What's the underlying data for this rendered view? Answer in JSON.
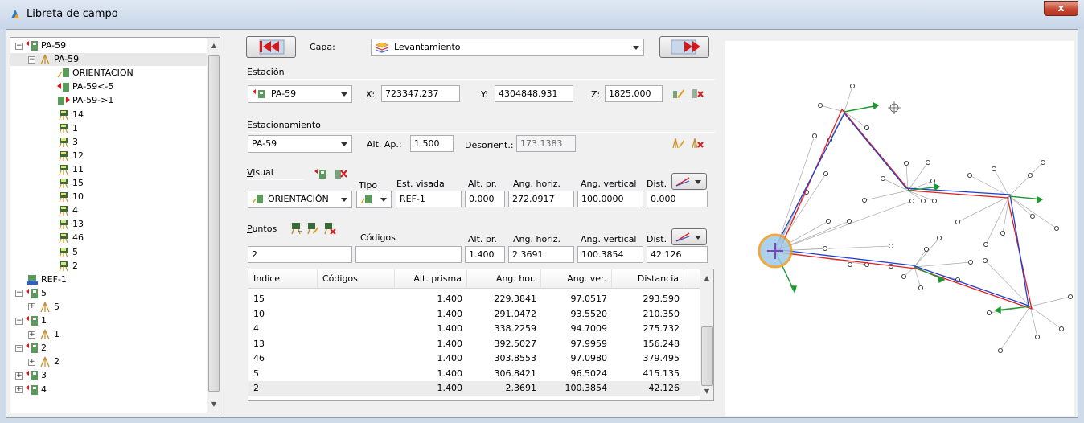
{
  "window": {
    "title": "Libreta de campo",
    "close_label": "x"
  },
  "tree": {
    "rows": [
      {
        "label": "PA-59",
        "level": 0,
        "toggle": "−",
        "icon": "station-pair-icon"
      },
      {
        "label": "PA-59",
        "level": 1,
        "toggle": "−",
        "icon": "tripod-icon",
        "selected": true
      },
      {
        "label": "ORIENTACIÓN",
        "level": 2,
        "icon": "orientation-icon"
      },
      {
        "label": "PA-59<-5",
        "level": 2,
        "icon": "backsight-icon"
      },
      {
        "label": "PA-59->1",
        "level": 2,
        "icon": "foresight-icon"
      },
      {
        "label": "14",
        "level": 2,
        "icon": "point-icon"
      },
      {
        "label": "1",
        "level": 2,
        "icon": "point-icon"
      },
      {
        "label": "3",
        "level": 2,
        "icon": "point-icon"
      },
      {
        "label": "12",
        "level": 2,
        "icon": "point-icon"
      },
      {
        "label": "11",
        "level": 2,
        "icon": "point-icon"
      },
      {
        "label": "15",
        "level": 2,
        "icon": "point-icon"
      },
      {
        "label": "10",
        "level": 2,
        "icon": "point-icon"
      },
      {
        "label": "4",
        "level": 2,
        "icon": "point-icon"
      },
      {
        "label": "13",
        "level": 2,
        "icon": "point-icon"
      },
      {
        "label": "46",
        "level": 2,
        "icon": "point-icon"
      },
      {
        "label": "5",
        "level": 2,
        "icon": "point-icon"
      },
      {
        "label": "2",
        "level": 2,
        "icon": "point-icon"
      },
      {
        "label": "REF-1",
        "level": 0,
        "icon": "reference-icon"
      },
      {
        "label": "5",
        "level": 0,
        "toggle": "−",
        "icon": "station-pair-icon"
      },
      {
        "label": "5",
        "level": 1,
        "toggle": "+",
        "icon": "tripod-icon"
      },
      {
        "label": "1",
        "level": 0,
        "toggle": "−",
        "icon": "station-pair-icon"
      },
      {
        "label": "1",
        "level": 1,
        "toggle": "+",
        "icon": "tripod-icon"
      },
      {
        "label": "2",
        "level": 0,
        "toggle": "−",
        "icon": "station-pair-icon"
      },
      {
        "label": "2",
        "level": 1,
        "toggle": "+",
        "icon": "tripod-icon"
      },
      {
        "label": "3",
        "level": 0,
        "toggle": "+",
        "icon": "station-pair-icon"
      },
      {
        "label": "4",
        "level": 0,
        "toggle": "+",
        "icon": "station-pair-icon"
      }
    ]
  },
  "toolbar": {
    "capa_label": "Capa:",
    "capa_value": "Levantamiento"
  },
  "estacion": {
    "title": "Estación",
    "station": "PA-59",
    "x_label": "X:",
    "x_value": "723347.237",
    "y_label": "Y:",
    "y_value": "4304848.931",
    "z_label": "Z:",
    "z_value": "1825.000"
  },
  "estacionamiento": {
    "title": "Estacionamiento",
    "value": "PA-59",
    "alt_label": "Alt. Ap.:",
    "alt_value": "1.500",
    "desor_label": "Desorient.:",
    "desor_value": "173.1383"
  },
  "visual": {
    "title": "Visual",
    "tipo_label": "Tipo",
    "est_label": "Est. visada",
    "altpr_label": "Alt. pr.",
    "horiz_label": "Ang. horiz.",
    "vert_label": "Ang. vertical",
    "dist_label": "Dist.",
    "value": "ORIENTACIÓN",
    "est_value": "REF-1",
    "altpr_value": "0.000",
    "horiz_value": "272.0917",
    "vert_value": "100.0000",
    "dist_value": "0.000"
  },
  "puntos": {
    "title": "Puntos",
    "codigos_label": "Códigos",
    "altpr_label": "Alt. pr.",
    "horiz_label": "Ang. horiz.",
    "vert_label": "Ang. vertical",
    "dist_label": "Dist.",
    "point_value": "2",
    "codigos_value": "",
    "altpr_value": "1.400",
    "horiz_value": "2.3691",
    "vert_value": "100.3854",
    "dist_value": "42.126"
  },
  "table": {
    "headers": [
      "Indice",
      "Códigos",
      "Alt. prisma",
      "Ang. hor.",
      "Ang. ver.",
      "Distancia"
    ],
    "rows": [
      [
        "15",
        "",
        "1.400",
        "229.3841",
        "97.0517",
        "293.590"
      ],
      [
        "10",
        "",
        "1.400",
        "291.0472",
        "93.5520",
        "210.350"
      ],
      [
        "4",
        "",
        "1.400",
        "338.2259",
        "94.7009",
        "275.732"
      ],
      [
        "13",
        "",
        "1.400",
        "392.5027",
        "97.9959",
        "156.248"
      ],
      [
        "46",
        "",
        "1.400",
        "303.8553",
        "97.0980",
        "379.495"
      ],
      [
        "5",
        "",
        "1.400",
        "306.8421",
        "96.5024",
        "415.135"
      ],
      [
        "2",
        "",
        "1.400",
        "2.3691",
        "100.3854",
        "42.126"
      ]
    ],
    "selected_index": 6
  },
  "colors": {
    "selection": "#e8e8e8",
    "traverse_red": "#e02020",
    "traverse_blue": "#2040d0",
    "arrow_green": "#1a9a30"
  }
}
